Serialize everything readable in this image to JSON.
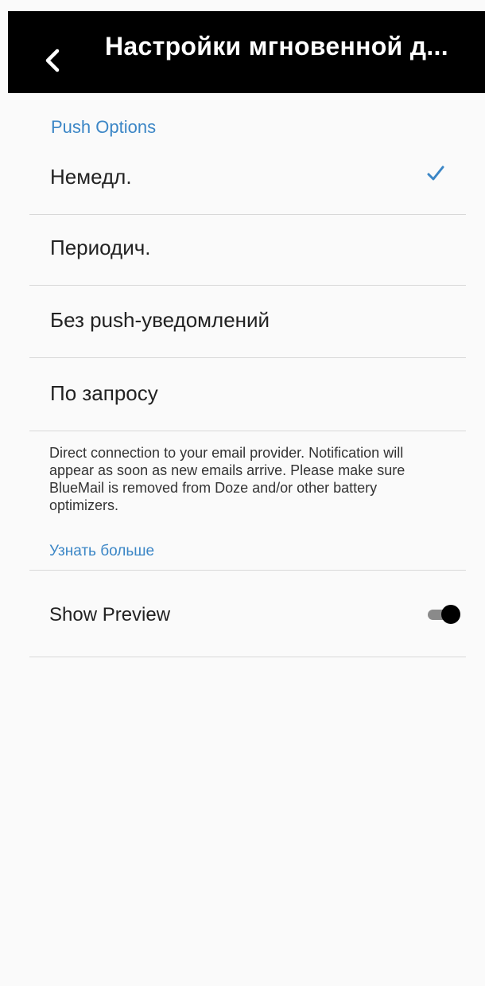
{
  "header": {
    "title": "Настройки мгновенной д...",
    "back_icon": "chevron-left-icon"
  },
  "section": {
    "header": "Push Options"
  },
  "options": [
    {
      "label": "Немедл.",
      "selected": true
    },
    {
      "label": "Периодич.",
      "selected": false
    },
    {
      "label": "Без push-уведомлений",
      "selected": false
    },
    {
      "label": "По запросу",
      "selected": false
    }
  ],
  "description": "Direct connection to your email provider. Notification will appear as soon as new emails arrive. Please make sure BlueMail is removed from Doze and/or other battery optimizers.",
  "learn_more": "Узнать больше",
  "preview": {
    "label": "Show Preview",
    "enabled": true
  },
  "colors": {
    "accent": "#3b86c6",
    "appbar": "#000000",
    "background": "#fafafa"
  }
}
